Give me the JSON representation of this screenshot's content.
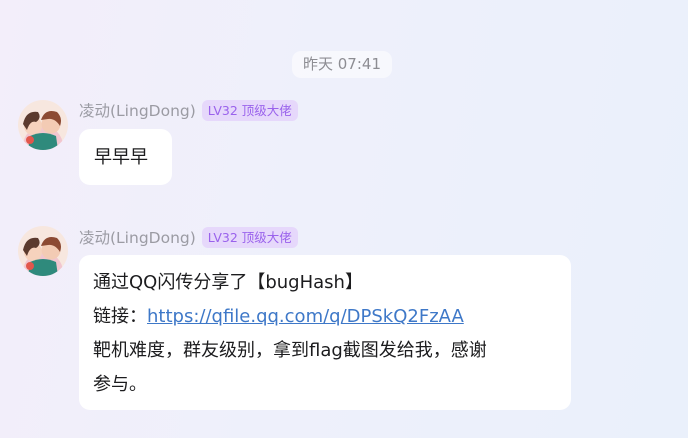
{
  "timestamp": "昨天 07:41",
  "colors": {
    "badge_bg": "#e6d8fb",
    "badge_text": "#9a62ec",
    "link": "#3e78c8",
    "bubble_bg": "#ffffff"
  },
  "messages": [
    {
      "sender": "凌动(LingDong)",
      "badge": "LV32 顶级大佬",
      "avatar_icon": "user-avatar-icon",
      "text": "早早早"
    },
    {
      "sender": "凌动(LingDong)",
      "badge": "LV32 顶级大佬",
      "avatar_icon": "user-avatar-icon",
      "line1": "通过QQ闪传分享了【bugHash】",
      "link_label": "链接：",
      "link_url": "https://qfile.qq.com/q/DPSkQ2FzAA",
      "line3": "靶机难度，群友级别，拿到flag截图发给我，感谢",
      "line4": "参与。"
    }
  ]
}
